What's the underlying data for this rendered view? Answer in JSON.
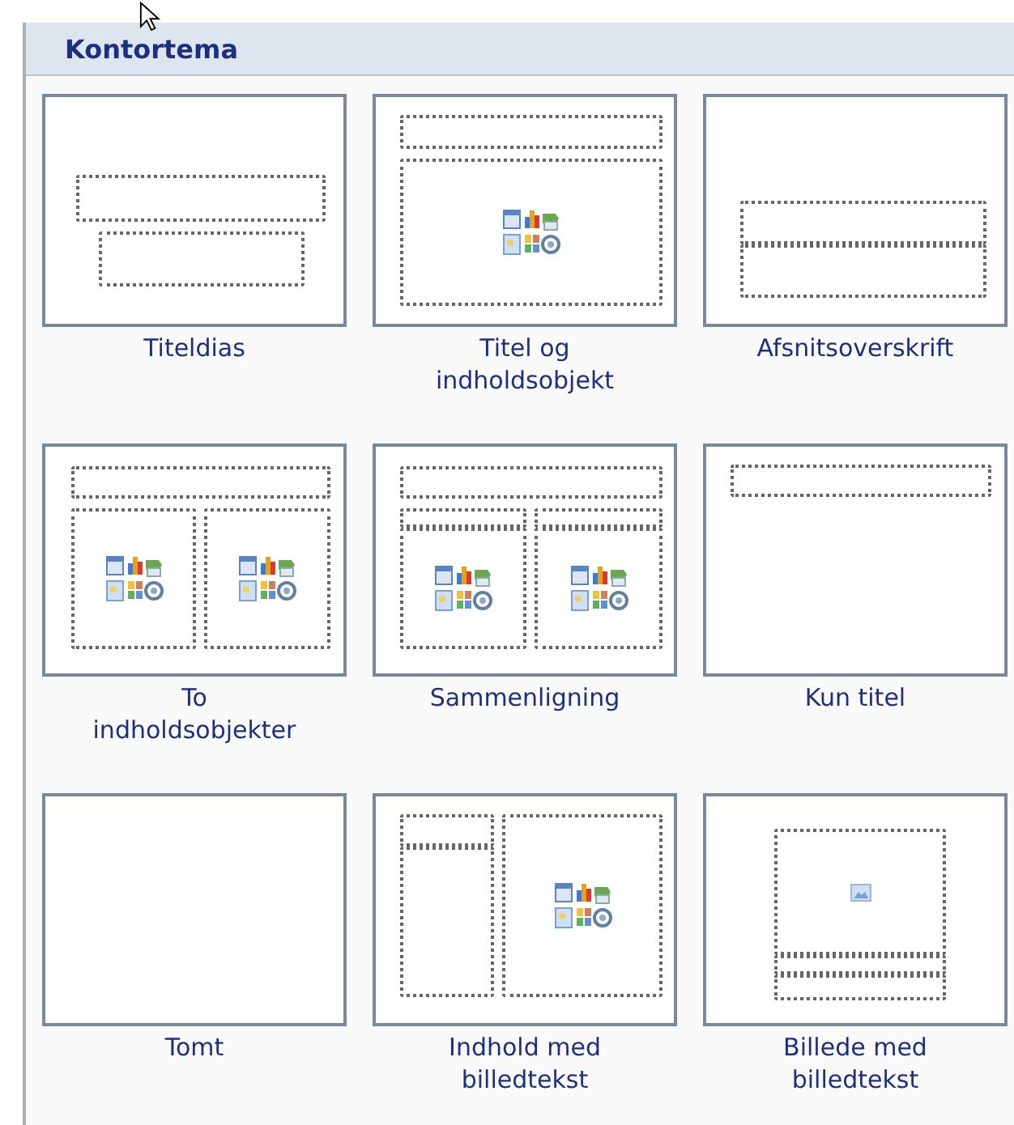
{
  "gallery": {
    "title": "Kontortema",
    "layouts": [
      {
        "label": "Titeldias",
        "kind": "title",
        "selected": false
      },
      {
        "label": "Titel og\nindholdsobjekt",
        "kind": "title-content",
        "selected": false
      },
      {
        "label": "Afsnitsoverskrift",
        "kind": "section",
        "selected": false
      },
      {
        "label": "To\nindholdsobjekter",
        "kind": "two-content",
        "selected": false
      },
      {
        "label": "Sammenligning",
        "kind": "comparison",
        "selected": false
      },
      {
        "label": "Kun titel",
        "kind": "title-only",
        "selected": false
      },
      {
        "label": "Tomt",
        "kind": "blank",
        "selected": false
      },
      {
        "label": "Indhold med\nbilledtekst",
        "kind": "content-caption",
        "selected": false
      },
      {
        "label": "Billede med\nbilledtekst",
        "kind": "picture-caption",
        "selected": false
      }
    ]
  }
}
